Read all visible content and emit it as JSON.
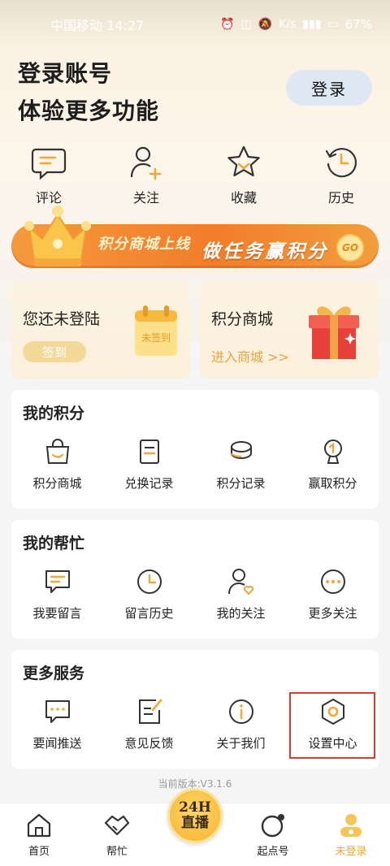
{
  "status_bar": {
    "carrier_time": "中国移动 14:27",
    "network": "K/s",
    "battery": "67%"
  },
  "hero": {
    "line1": "登录账号",
    "line2": "体验更多功能",
    "login_label": "登录"
  },
  "quick_actions": [
    {
      "label": "评论",
      "icon": "comment-icon"
    },
    {
      "label": "关注",
      "icon": "follow-user-icon"
    },
    {
      "label": "收藏",
      "icon": "star-icon"
    },
    {
      "label": "历史",
      "icon": "history-icon"
    }
  ],
  "banner": {
    "left_text": "积分商城上线",
    "right_text": "做任务赢积分",
    "go_label": "GO"
  },
  "signin_card": {
    "title": "您还未登陆",
    "button": "签到",
    "calendar_text": "未签到"
  },
  "mall_card": {
    "title": "积分商城",
    "link": "进入商城 >>"
  },
  "sections": {
    "points": {
      "title": "我的积分",
      "items": [
        {
          "label": "积分商城",
          "icon": "shopping-bag-icon"
        },
        {
          "label": "兑换记录",
          "icon": "document-icon"
        },
        {
          "label": "积分记录",
          "icon": "coins-icon"
        },
        {
          "label": "赢取积分",
          "icon": "trophy-icon"
        }
      ]
    },
    "help": {
      "title": "我的帮忙",
      "items": [
        {
          "label": "我要留言",
          "icon": "message-icon"
        },
        {
          "label": "留言历史",
          "icon": "clock-icon"
        },
        {
          "label": "我的关注",
          "icon": "user-heart-icon"
        },
        {
          "label": "更多关注",
          "icon": "more-dots-icon"
        }
      ]
    },
    "services": {
      "title": "更多服务",
      "items": [
        {
          "label": "要闻推送",
          "icon": "chat-dots-icon"
        },
        {
          "label": "意见反馈",
          "icon": "feedback-edit-icon"
        },
        {
          "label": "关于我们",
          "icon": "info-icon"
        },
        {
          "label": "设置中心",
          "icon": "settings-hex-icon"
        }
      ]
    }
  },
  "version": "当前版本:V3.1.6",
  "bottom_nav": {
    "items": [
      {
        "label": "首页",
        "icon": "home-icon"
      },
      {
        "label": "帮忙",
        "icon": "handshake-icon"
      },
      {
        "label": "起点号",
        "icon": "circle-dot-icon"
      },
      {
        "label": "未登录",
        "icon": "avatar-icon"
      }
    ],
    "live_line1": "24H",
    "live_line2": "直播"
  },
  "colors": {
    "accent": "#f0a83a",
    "banner_orange": "#f27d2a",
    "highlight_red": "#e23b2e"
  }
}
